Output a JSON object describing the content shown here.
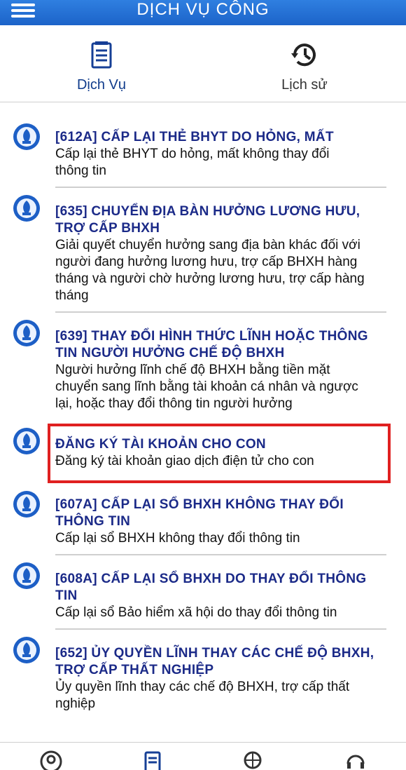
{
  "header": {
    "title": "DỊCH VỤ CÔNG",
    "menu_icon": "hamburger-menu-icon"
  },
  "tabs": [
    {
      "label": "Dịch Vụ",
      "icon": "document-list-icon",
      "active": true
    },
    {
      "label": "Lịch sử",
      "icon": "history-clock-icon",
      "active": false
    }
  ],
  "services": [
    {
      "title_lines": [
        "[612A] CẤP LẠI THẺ BHYT DO HỎNG, MẤT"
      ],
      "desc_lines": [
        "Cấp lại thẻ BHYT do hỏng, mất không thay đổi",
        "thông tin"
      ]
    },
    {
      "title_lines": [
        "[635] CHUYỂN ĐỊA BÀN HƯỞNG LƯƠNG HƯU,",
        "TRỢ CẤP BHXH"
      ],
      "desc_lines": [
        "Giải quyết chuyển hưởng sang địa bàn khác đối với",
        "người đang hưởng lương hưu, trợ cấp BHXH hàng",
        "tháng và người chờ hưởng lương hưu, trợ cấp hàng",
        "tháng"
      ]
    },
    {
      "title_lines": [
        "[639] THAY ĐỔI HÌNH THỨC LĨNH HOẶC THÔNG",
        "TIN NGƯỜI HƯỞNG CHẾ ĐỘ BHXH"
      ],
      "desc_lines": [
        "Người hưởng lĩnh chế độ BHXH bằng tiền mặt",
        "chuyển sang lĩnh bằng tài khoản cá nhân và ngược",
        "lại, hoặc thay đổi thông tin người hưởng"
      ]
    },
    {
      "title_lines": [
        "ĐĂNG KÝ TÀI KHOẢN CHO CON"
      ],
      "desc_lines": [
        "Đăng ký tài khoản giao dịch điện tử cho con"
      ]
    },
    {
      "title_lines": [
        "[607A] CẤP LẠI SỔ BHXH KHÔNG THAY ĐỔI",
        "THÔNG TIN"
      ],
      "desc_lines": [
        "Cấp lại sổ BHXH không thay đổi thông tin"
      ]
    },
    {
      "title_lines": [
        "[608A] CẤP LẠI SỔ BHXH DO THAY ĐỔI THÔNG",
        "TIN"
      ],
      "desc_lines": [
        "Cấp lại sổ Bảo hiểm xã hội do thay đổi thông tin"
      ]
    },
    {
      "title_lines": [
        "[652] ỦY QUYỀN LĨNH THAY CÁC CHẾ ĐỘ BHXH,",
        "TRỢ CẤP THẤT NGHIỆP"
      ],
      "desc_lines": [
        "Ủy quyền lĩnh thay các chế độ BHXH, trợ cấp thất",
        "nghiệp"
      ]
    }
  ],
  "service_icon": "bhxh-logo-icon",
  "bottom_nav": [
    "account-icon",
    "services-doc-icon",
    "search-globe-icon",
    "support-headset-icon"
  ],
  "colors": {
    "header_blue": "#1c63c9",
    "title_navy": "#1b2a88",
    "highlight_red": "#e02020"
  }
}
